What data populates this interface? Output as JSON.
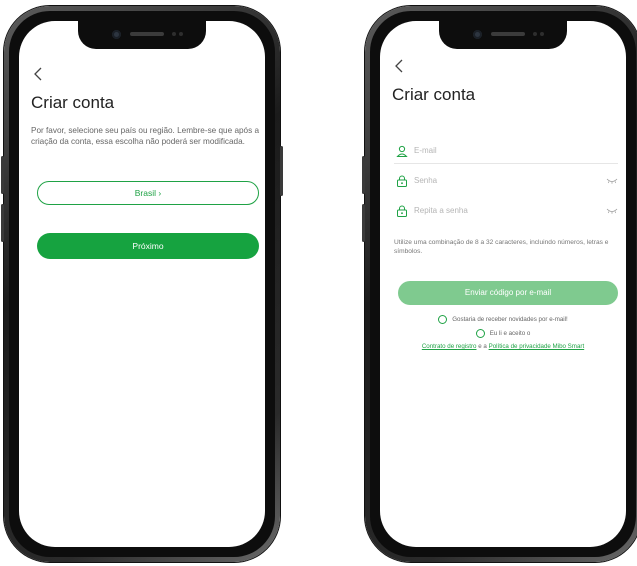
{
  "screen1": {
    "back_icon": "chevron-left-icon",
    "title": "Criar conta",
    "description": "Por favor, selecione seu país ou região. Lembre-se que após a criação da conta, essa escolha não poderá ser modificada.",
    "country_button": "Brasil ›",
    "next_button": "Próximo"
  },
  "screen2": {
    "back_icon": "chevron-left-icon",
    "title": "Criar conta",
    "email_placeholder": "E-mail",
    "password_placeholder": "Senha",
    "repeat_password_placeholder": "Repita a senha",
    "password_hint": "Utilize uma combinação de 8 a 32 caracteres, incluindo números, letras e símbolos.",
    "send_button": "Enviar código por e-mail",
    "newsletter_checkbox": "Gostaria de receber novidades por e-mail!",
    "terms_checkbox": "Eu li e aceito o",
    "terms_link": "Contrato de registro",
    "terms_connector": "e a",
    "privacy_link": "Política de privacidade Mibo Smart"
  },
  "colors": {
    "accent": "#16a340",
    "accent_light": "#7fca8f",
    "phone_frame": "#1b1b1b"
  }
}
